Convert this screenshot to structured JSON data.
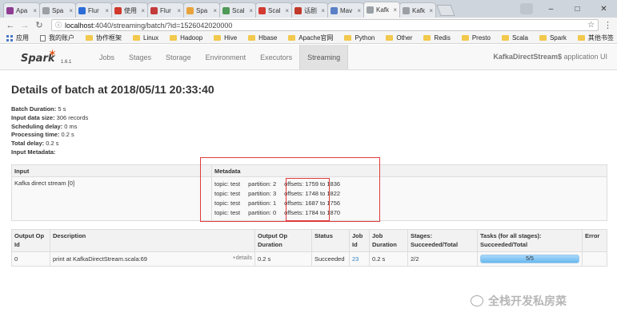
{
  "browser": {
    "tabs": [
      {
        "title": "Apa",
        "color": "#8e3b92"
      },
      {
        "title": "Spa",
        "color": "#9aa0a6"
      },
      {
        "title": "Flur",
        "color": "#2c6cd6"
      },
      {
        "title": "使用",
        "color": "#d0392b"
      },
      {
        "title": "Flur",
        "color": "#c43b3b"
      },
      {
        "title": "Spa",
        "color": "#e8a33a"
      },
      {
        "title": "Scal",
        "color": "#4f9a56"
      },
      {
        "title": "Scal",
        "color": "#d33a32"
      },
      {
        "title": "话剧",
        "color": "#c0392b"
      },
      {
        "title": "Mav",
        "color": "#5a7fc7"
      },
      {
        "title": "Kafk",
        "color": "#9aa0a6"
      },
      {
        "title": "Kafk",
        "color": "#9aa0a6"
      }
    ],
    "url_prefix": "",
    "url_host": "localhost",
    "url_rest": ":4040/streaming/batch/?id=1526042020000",
    "bookmarks": [
      "应用",
      "我的账户",
      "协作框架",
      "Linux",
      "Hadoop",
      "Hive",
      "Hbase",
      "Apache官网",
      "Python",
      "Other",
      "Redis",
      "Presto",
      "Scala",
      "Spark"
    ],
    "bookmark_right": "其他书签"
  },
  "spark": {
    "logo_text": "Spark",
    "version": "1.6.1",
    "nav": [
      "Jobs",
      "Stages",
      "Storage",
      "Environment",
      "Executors",
      "Streaming"
    ],
    "app_name_bold": "KafkaDirectStream$",
    "app_name_suffix": " application UI"
  },
  "page": {
    "title": "Details of batch at 2018/05/11 20:33:40",
    "summary": [
      {
        "label": "Batch Duration:",
        "value": " 5 s"
      },
      {
        "label": "Input data size:",
        "value": " 306 records"
      },
      {
        "label": "Scheduling delay:",
        "value": " 0 ms"
      },
      {
        "label": "Processing time:",
        "value": " 0.2 s"
      },
      {
        "label": "Total delay:",
        "value": " 0.2 s"
      },
      {
        "label": "Input Metadata:",
        "value": ""
      }
    ]
  },
  "input_table": {
    "headers": [
      "Input",
      "Metadata"
    ],
    "input": "Kafka direct stream [0]",
    "rows": [
      {
        "topic": "topic: test",
        "partition": "partition: 2",
        "offsets": "offsets: 1759 to 1836"
      },
      {
        "topic": "topic: test",
        "partition": "partition: 3",
        "offsets": "offsets: 1748 to 1822"
      },
      {
        "topic": "topic: test",
        "partition": "partition: 1",
        "offsets": "offsets: 1687 to 1756"
      },
      {
        "topic": "topic: test",
        "partition": "partition: 0",
        "offsets": "offsets: 1784 to 1870"
      }
    ]
  },
  "ops_table": {
    "headers": [
      "Output Op Id",
      "Description",
      "Output Op Duration",
      "Status",
      "Job Id",
      "Job Duration",
      "Stages: Succeeded/Total",
      "Tasks (for all stages): Succeeded/Total",
      "Error"
    ],
    "row": {
      "id": "0",
      "description": "print at KafkaDirectStream.scala:69",
      "details": "+details",
      "op_duration": "0.2 s",
      "status": "Succeeded",
      "job_id": "23",
      "job_duration": "0.2 s",
      "stages": "2/2",
      "tasks": "5/5",
      "tasks_progress": 1.0,
      "error": ""
    }
  },
  "watermark": "全栈开发私房菜",
  "colors": {
    "accent_red": "#e03a3a",
    "link": "#2a7fc1",
    "progress": "#68b8ef"
  }
}
